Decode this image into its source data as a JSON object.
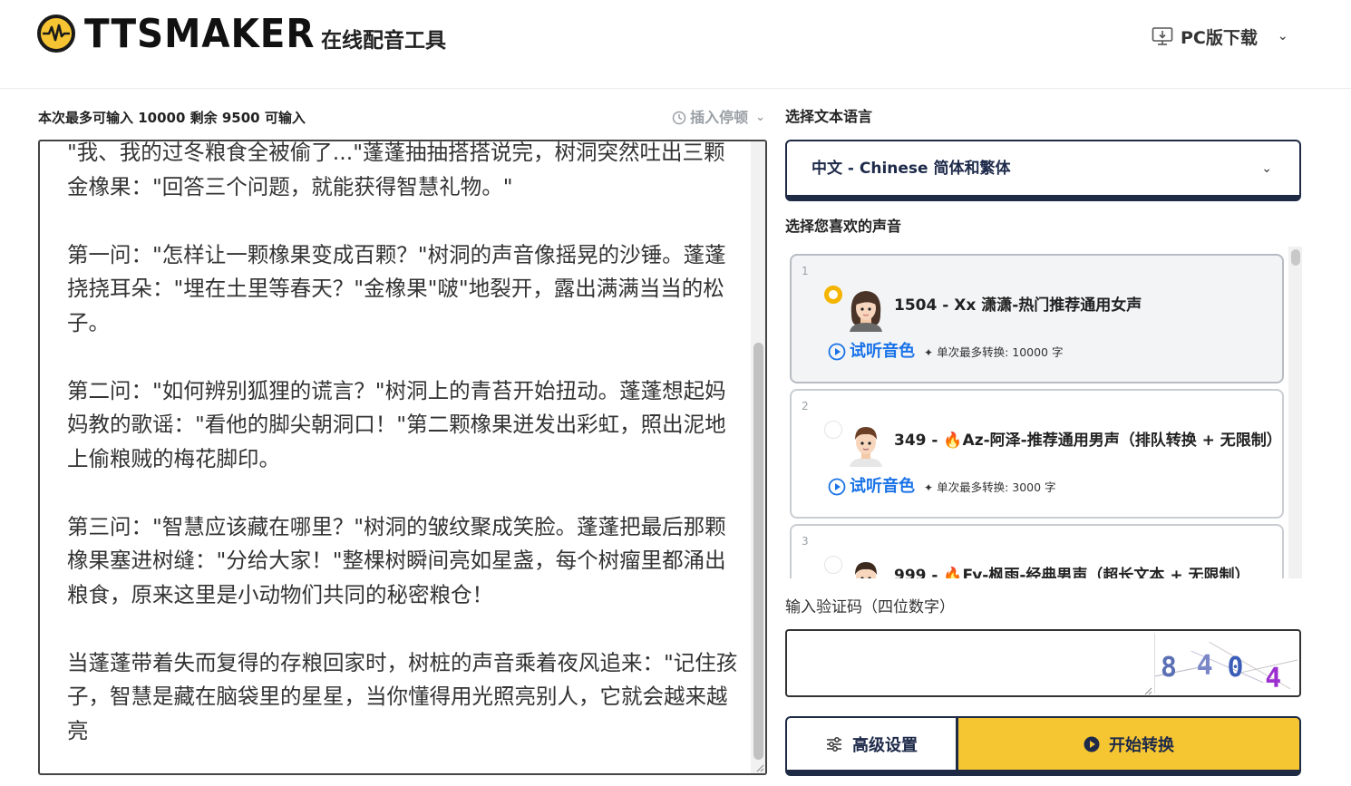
{
  "header": {
    "logo_text": "TTSMAKER",
    "tagline": "在线配音工具",
    "pc_download": "PC版下载"
  },
  "editor": {
    "char_count": "本次最多可输入 10000 剩余 9500 可输入",
    "insert_pause": "插入停顿",
    "text": "\"我、我的过冬粮食全被偷了...\"蓬蓬抽抽搭搭说完，树洞突然吐出三颗金橡果：\"回答三个问题，就能获得智慧礼物。\"\n\n第一问：\"怎样让一颗橡果变成百颗？\"树洞的声音像摇晃的沙锤。蓬蓬挠挠耳朵：\"埋在土里等春天？\"金橡果\"啵\"地裂开，露出满满当当的松子。\n\n第二问：\"如何辨别狐狸的谎言？\"树洞上的青苔开始扭动。蓬蓬想起妈妈教的歌谣：\"看他的脚尖朝洞口！\"第二颗橡果迸发出彩虹，照出泥地上偷粮贼的梅花脚印。\n\n第三问：\"智慧应该藏在哪里？\"树洞的皱纹聚成笑脸。蓬蓬把最后那颗橡果塞进树缝：\"分给大家！\"整棵树瞬间亮如星盏，每个树瘤里都涌出粮食，原来这里是小动物们共同的秘密粮仓！\n\n当蓬蓬带着失而复得的存粮回家时，树桩的声音乘着夜风追来：\"记住孩子，智慧是藏在脑袋里的星星，当你懂得用光照亮别人，它就会越来越亮"
  },
  "language": {
    "label": "选择文本语言",
    "selected": "中文 - Chinese 简体和繁体"
  },
  "voices": {
    "label": "选择您喜欢的声音",
    "preview_label": "试听音色",
    "items": [
      {
        "num": "1",
        "name": "1504 - Xx 潇潇-热门推荐通用女声",
        "limit": "单次最多转换: 10000 字",
        "selected": true
      },
      {
        "num": "2",
        "name": "349 - 🔥Az-阿泽-推荐通用男声（排队转换 + 无限制）",
        "limit": "单次最多转换: 3000 字",
        "selected": false
      },
      {
        "num": "3",
        "name": "999 - 🔥Fy-枫雨-经典男声（超长文本 + 无限制）",
        "limit": "",
        "selected": false
      }
    ]
  },
  "captcha": {
    "label": "输入验证码（四位数字）",
    "input_value": "",
    "code": [
      "8",
      "4",
      "0",
      "4"
    ]
  },
  "buttons": {
    "advanced": "高级设置",
    "start": "开始转换"
  },
  "colors": {
    "accent_yellow": "#f6c632",
    "navy": "#1f2a44",
    "link_blue": "#1a73e8"
  }
}
